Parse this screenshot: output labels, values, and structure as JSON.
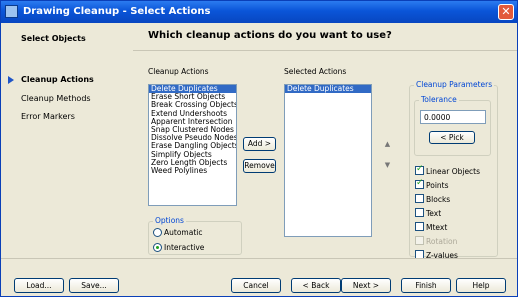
{
  "window": {
    "title": "Drawing Cleanup - Select Actions",
    "close_glyph": "✕"
  },
  "sidebar": {
    "items": [
      {
        "label": "Select Objects"
      },
      {
        "label": "Cleanup Actions"
      },
      {
        "label": "Cleanup Methods"
      },
      {
        "label": "Error Markers"
      }
    ]
  },
  "main": {
    "question": "Which cleanup actions do you want to use?",
    "cleanup_actions_label": "Cleanup Actions",
    "cleanup_actions": [
      "Delete Duplicates",
      "Erase Short Objects",
      "Break Crossing Objects",
      "Extend Undershoots",
      "Apparent Intersection",
      "Snap Clustered Nodes",
      "Dissolve Pseudo Nodes",
      "Erase Dangling Objects",
      "Simplify Objects",
      "Zero Length Objects",
      "Weed Polylines"
    ],
    "selected_actions_label": "Selected Actions",
    "selected_actions": [
      "Delete Duplicates"
    ],
    "add_label": "Add >",
    "remove_label": "Remove",
    "options": {
      "label": "Options",
      "automatic": "Automatic",
      "interactive": "Interactive",
      "selected": "Interactive"
    },
    "parameters": {
      "label": "Cleanup Parameters",
      "tolerance_label": "Tolerance",
      "tolerance_value": "0.0000",
      "pick_label": "< Pick",
      "linear_objects": "Linear Objects",
      "points": "Points",
      "blocks": "Blocks",
      "text": "Text",
      "mtext": "Mtext",
      "rotation": "Rotation",
      "z_values": "Z-values",
      "checked": [
        "Linear Objects",
        "Points"
      ]
    }
  },
  "footer": {
    "load_label": "Load...",
    "save_label": "Save...",
    "cancel_label": "Cancel",
    "back_label": "< Back",
    "next_label": "Next >",
    "finish_label": "Finish",
    "help_label": "Help"
  },
  "colors": {
    "title_bar": "#0a55d8",
    "selection": "#316ac5",
    "group_label": "#0046d5",
    "close_button": "#e2593b"
  }
}
